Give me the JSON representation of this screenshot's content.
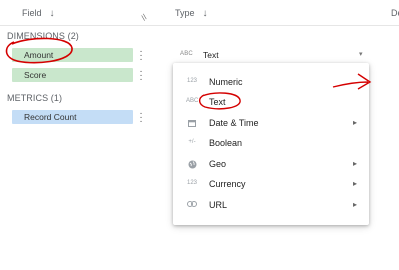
{
  "header": {
    "field_label": "Field",
    "type_label": "Type",
    "description_label": "De",
    "sort_arrow": "↓"
  },
  "dimensions": {
    "title": "DIMENSIONS (2)",
    "items": [
      {
        "label": "Amount"
      },
      {
        "label": "Score"
      }
    ]
  },
  "metrics": {
    "title": "METRICS (1)",
    "items": [
      {
        "label": "Record Count"
      }
    ]
  },
  "type_selector": {
    "icon_text": "ABC",
    "value": "Text"
  },
  "type_menu": {
    "items": [
      {
        "icon_text": "123",
        "label": "Numeric",
        "has_submenu": false
      },
      {
        "icon_text": "ABC",
        "label": "Text",
        "has_submenu": false
      },
      {
        "icon_text": "",
        "label": "Date & Time",
        "has_submenu": true
      },
      {
        "icon_text": "+/-",
        "label": "Boolean",
        "has_submenu": false
      },
      {
        "icon_text": "",
        "label": "Geo",
        "has_submenu": true
      },
      {
        "icon_text": "123",
        "label": "Currency",
        "has_submenu": true
      },
      {
        "icon_text": "",
        "label": "URL",
        "has_submenu": true
      }
    ]
  },
  "colors": {
    "dimension_chip": "#c9e7cc",
    "metric_chip": "#c4ddf6",
    "annotation": "#d40000"
  }
}
